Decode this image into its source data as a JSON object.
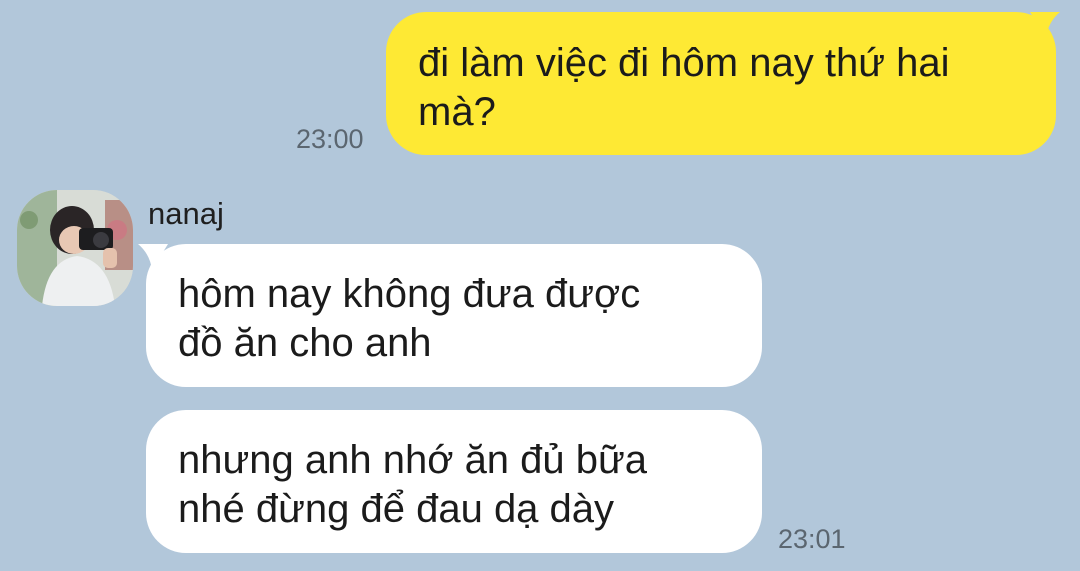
{
  "conversation": {
    "outgoing": {
      "text": "đi làm việc đi hôm nay thứ hai\nmà?",
      "time": "23:00"
    },
    "incoming": {
      "sender": "nanaj",
      "messages": [
        {
          "text": "hôm nay không đưa được\nđồ ăn cho anh"
        },
        {
          "text": "nhưng anh nhớ ăn đủ bữa\nnhé đừng để đau dạ dày"
        }
      ],
      "time": "23:01"
    }
  },
  "colors": {
    "background": "#b2c7da",
    "outgoing_bubble": "#fee934",
    "incoming_bubble": "#ffffff"
  }
}
